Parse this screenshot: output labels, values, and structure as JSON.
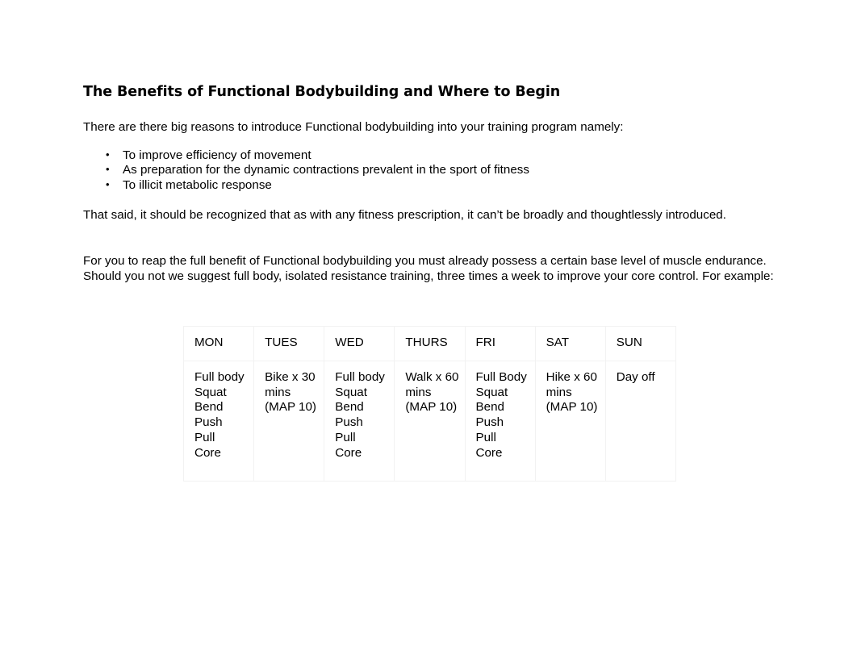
{
  "document": {
    "title": "The Benefits of Functional Bodybuilding and Where to Begin",
    "intro_paragraph": "There are there big reasons to introduce Functional bodybuilding into your training program namely:",
    "bullets": [
      "To improve efficiency of movement",
      "As preparation for the dynamic contractions prevalent in the sport of fitness",
      "To illicit metabolic response"
    ],
    "caveat_paragraph": "That said, it should be recognized that as with any fitness prescription, it can’t be broadly and thoughtlessly introduced.",
    "guidance_paragraph": "For you to reap the full benefit of Functional bodybuilding you must already possess a certain base level of muscle endurance. Should you not we suggest full body, isolated resistance training, three times a week to improve your core control. For example:"
  },
  "schedule_table": {
    "headers": [
      "MON",
      "TUES",
      "WED",
      "THURS",
      "FRI",
      "SAT",
      "SUN"
    ],
    "cells": [
      [
        "Full body",
        "Squat",
        "Bend",
        "Push",
        "Pull",
        "Core"
      ],
      [
        "Bike x 30",
        "mins",
        "(MAP 10)"
      ],
      [
        "Full body",
        "Squat",
        "Bend",
        "Push",
        "Pull",
        "Core"
      ],
      [
        "Walk x 60",
        "mins",
        "(MAP 10)"
      ],
      [
        "Full Body",
        "Squat",
        "Bend",
        "Push",
        "Pull",
        "Core"
      ],
      [
        "Hike x 60",
        "mins",
        "(MAP 10)"
      ],
      [
        "Day off"
      ]
    ],
    "border_color": "#f2f2f2"
  }
}
